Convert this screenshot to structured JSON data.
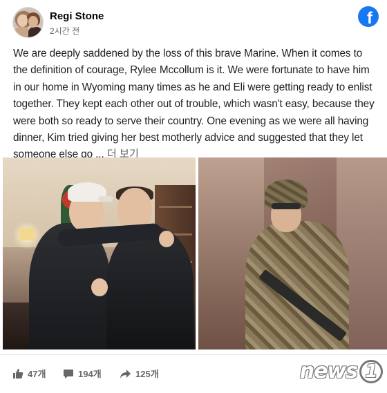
{
  "post": {
    "author": "Regi Stone",
    "timestamp": "2시간 전",
    "text": "We are deeply saddened by the loss of this brave Marine. When it comes to the definition of courage, Rylee Mccollum is it. We were fortunate to have him in our home in Wyoming many times as he and Eli were getting ready to enlist together. They kept each other out of trouble, which wasn't easy, because they were both so ready to serve their country. One evening as we were all having dinner, Kim tried giving her best motherly advice and suggested that they let someone else go ... ",
    "see_more": "더 보기"
  },
  "brand": {
    "logo_letter": "f",
    "accent": "#1877f2"
  },
  "reactions": {
    "likes": "47개",
    "comments": "194개",
    "shares": "125개"
  },
  "watermark": {
    "text": "news",
    "number": "1"
  },
  "icons": {
    "avatar": "profile-photo",
    "logo": "facebook-icon",
    "like": "thumbs-up-icon",
    "comment": "comment-icon",
    "share": "share-arrow-icon"
  }
}
